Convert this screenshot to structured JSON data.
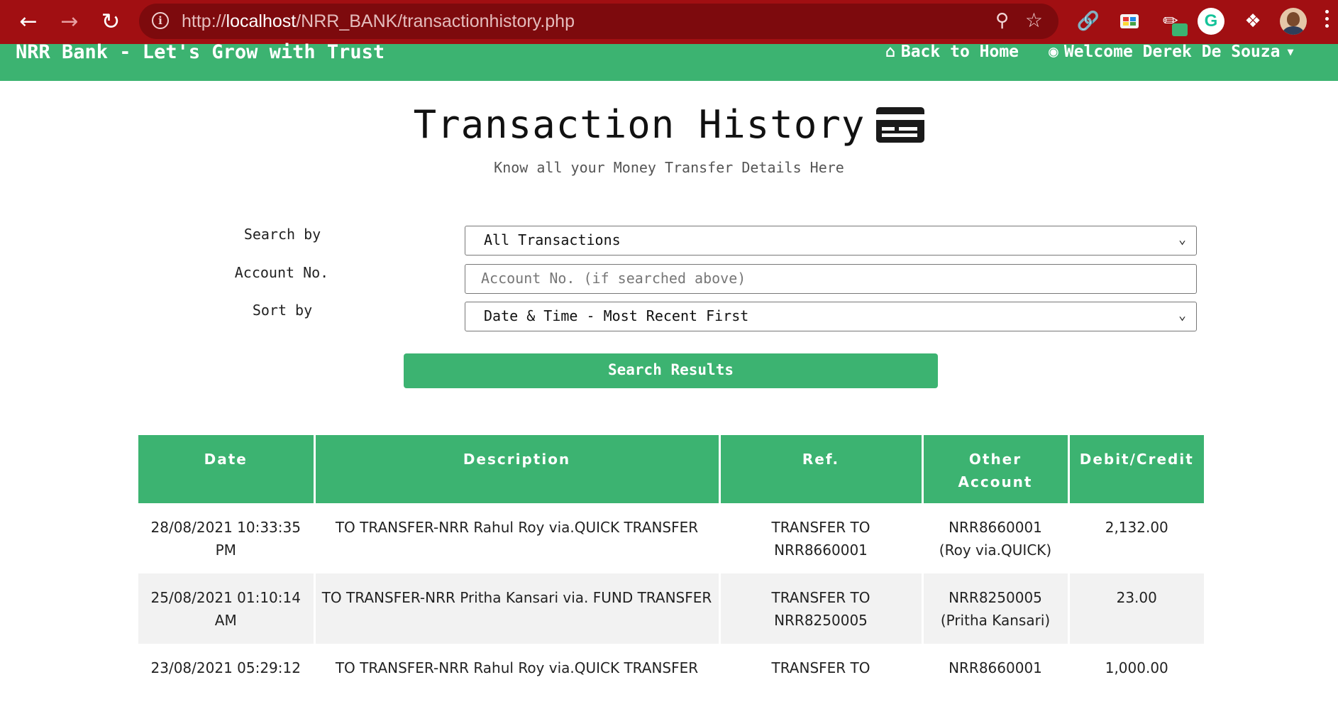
{
  "browser": {
    "url_prefix": "http://",
    "url_host": "localhost",
    "url_path": "/NRR_BANK/transactionhistory.php"
  },
  "site": {
    "brand": "NRR Bank - Let's Grow with Trust",
    "back_home": "Back to Home",
    "welcome": "Welcome Derek De Souza"
  },
  "page": {
    "title": "Transaction History",
    "subtitle": "Know all your Money Transfer Details Here"
  },
  "form": {
    "search_by_label": "Search by",
    "search_by_value": "All Transactions",
    "account_label": "Account No.",
    "account_placeholder": "Account No. (if searched above)",
    "sort_by_label": "Sort by",
    "sort_by_value": "Date & Time - Most Recent First",
    "submit_label": "Search Results"
  },
  "table": {
    "headers": {
      "date": "Date",
      "description": "Description",
      "ref": "Ref.",
      "other_account": "Other Account",
      "amount": "Debit/Credit"
    },
    "rows": [
      {
        "date": "28/08/2021 10:33:35 PM",
        "description": "TO TRANSFER-NRR Rahul Roy via.QUICK TRANSFER",
        "ref": "TRANSFER TO NRR8660001",
        "other_account": "NRR8660001 (Roy via.QUICK)",
        "amount": "2,132.00",
        "type": "credit"
      },
      {
        "date": "25/08/2021 01:10:14 AM",
        "description": "TO TRANSFER-NRR Pritha Kansari via. FUND TRANSFER",
        "ref": "TRANSFER TO NRR8250005",
        "other_account": "NRR8250005 (Pritha Kansari)",
        "amount": "23.00",
        "type": "debit"
      },
      {
        "date": "23/08/2021 05:29:12",
        "description": "TO TRANSFER-NRR Rahul Roy via.QUICK TRANSFER",
        "ref": "TRANSFER TO",
        "other_account": "NRR8660001",
        "amount": "1,000.00",
        "type": "debit"
      }
    ]
  },
  "colors": {
    "browser_chrome": "#a10f12",
    "brand_green": "#3cb371",
    "credit": "#1f7a1f",
    "debit": "#e01b24"
  }
}
